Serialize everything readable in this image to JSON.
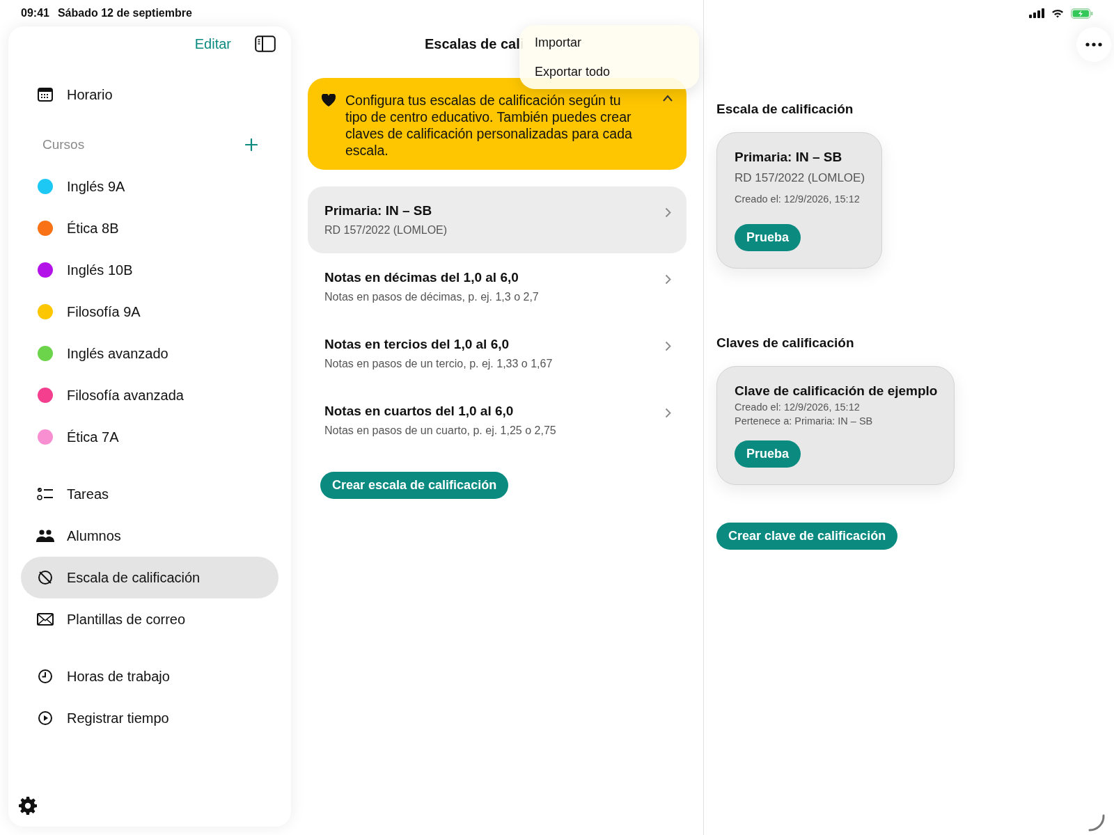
{
  "status_bar": {
    "time": "09:41",
    "date": "Sábado 12 de septiembre"
  },
  "sidebar": {
    "edit_label": "Editar",
    "top_items": [
      {
        "label": "Horario",
        "selected": false
      }
    ],
    "courses_heading": "Cursos",
    "courses": [
      {
        "name": "Inglés 9A",
        "color": "#1ec8f5"
      },
      {
        "name": "Ética 8B",
        "color": "#f97316"
      },
      {
        "name": "Inglés 10B",
        "color": "#b312e8"
      },
      {
        "name": "Filosofía 9A",
        "color": "#fcc700"
      },
      {
        "name": "Inglés avanzado",
        "color": "#6cd44a"
      },
      {
        "name": "Filosofía avanzada",
        "color": "#f43f8e"
      },
      {
        "name": "Ética 7A",
        "color": "#f78fd0"
      }
    ],
    "main_items": [
      {
        "label": "Tareas",
        "selected": false
      },
      {
        "label": "Alumnos",
        "selected": false
      },
      {
        "label": "Escala de calificación",
        "selected": true
      },
      {
        "label": "Plantillas de correo",
        "selected": false
      }
    ],
    "time_items": [
      {
        "label": "Horas de trabajo",
        "selected": false
      },
      {
        "label": "Registrar tiempo",
        "selected": false
      }
    ]
  },
  "content": {
    "title": "Escalas de cali",
    "banner": "Configura tus escalas de calificación según tu tipo de centro educativo. También puedes crear claves de calificación personalizadas para cada escala.",
    "scales": [
      {
        "title": "Primaria: IN – SB",
        "subtitle": "RD 157/2022 (LOMLOE)",
        "selected": true
      },
      {
        "title": "Notas en décimas del 1,0 al 6,0",
        "subtitle": "Notas en pasos de décimas, p. ej. 1,3 o 2,7",
        "selected": false
      },
      {
        "title": "Notas en tercios del 1,0 al 6,0",
        "subtitle": "Notas en pasos de un tercio, p. ej. 1,33 o 1,67",
        "selected": false
      },
      {
        "title": "Notas en cuartos del 1,0 al 6,0",
        "subtitle": "Notas en pasos de un cuarto, p. ej. 1,25 o 2,75",
        "selected": false
      }
    ],
    "create_button": "Crear escala de calificación"
  },
  "menu": {
    "items": [
      "Importar",
      "Exportar todo"
    ]
  },
  "detail": {
    "scale_heading": "Escala de calificación",
    "scale_card": {
      "title": "Primaria: IN – SB",
      "subtitle": "RD 157/2022 (LOMLOE)",
      "created": "Creado el: 12/9/2026, 15:12",
      "button": "Prueba"
    },
    "keys_heading": "Claves de calificación",
    "key_card": {
      "title": "Clave de calificación de ejemplo",
      "created": "Creado el: 12/9/2026, 15:12",
      "belongs": "Pertenece a: Primaria: IN – SB",
      "button": "Prueba"
    },
    "create_button": "Crear clave de calificación"
  }
}
